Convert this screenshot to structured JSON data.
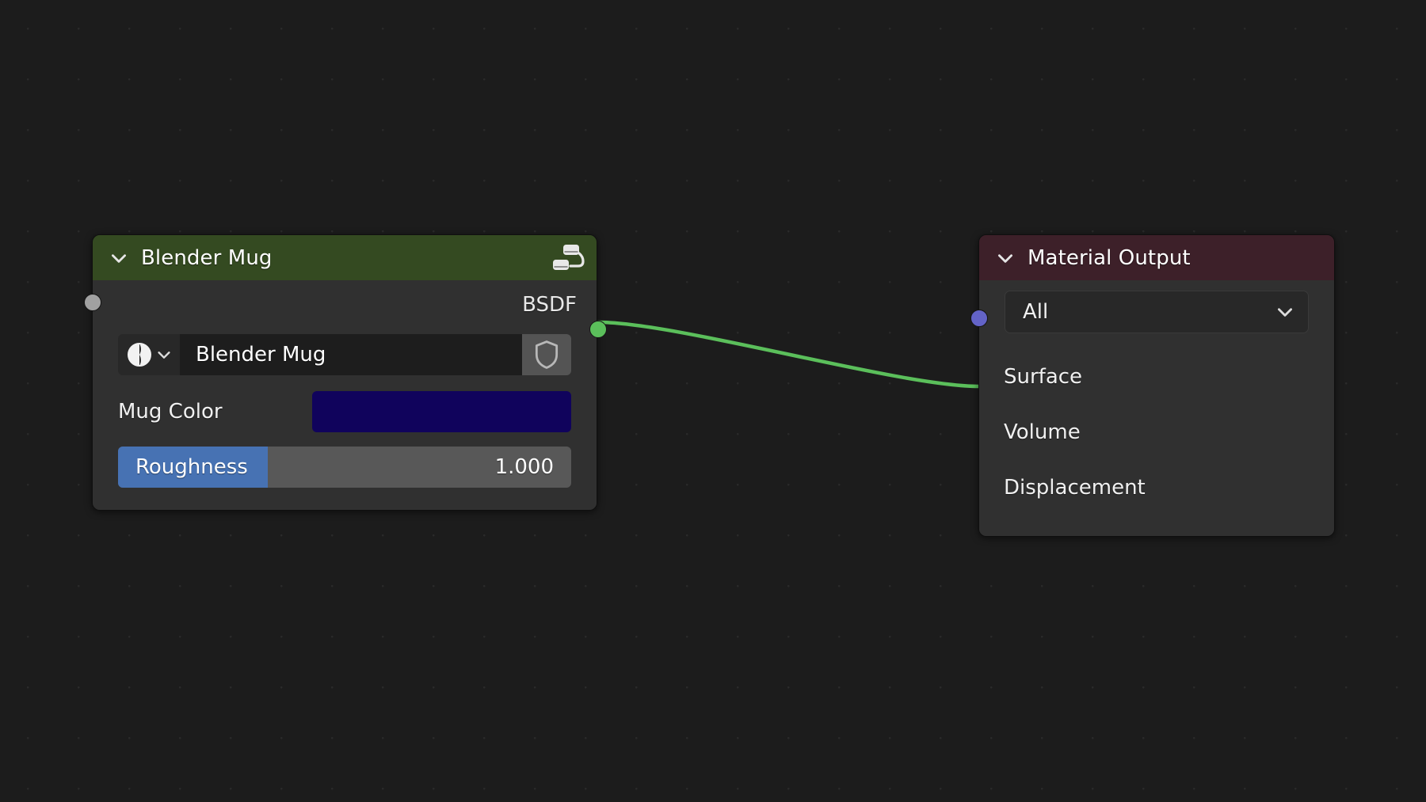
{
  "editor": {
    "name": "shader-node-editor",
    "background_color": "#1c1c1c",
    "grid_dot_color": "#2a2a2a"
  },
  "link": {
    "name": "bsdf-to-surface-link",
    "color": "#5bbf5b",
    "from": "Blender Mug : BSDF",
    "to": "Material Output : Surface"
  },
  "nodes": [
    {
      "id": "blender-mug",
      "title": "Blender Mug",
      "header_color": "#344a21",
      "body_color": "#303030",
      "collapse_icon": "chevron-down-icon",
      "header_icon": "node-group-icon",
      "outputs": [
        {
          "label": "BSDF",
          "socket_color": "#5bbf5b",
          "socket_name": "shader-socket"
        }
      ],
      "datablock": {
        "browse_icon": "material-sphere-icon",
        "browse_chevron": "chevron-down-icon",
        "value": "Blender Mug",
        "fake_user_icon": "shield-icon",
        "fake_user_enabled": "true"
      },
      "properties": [
        {
          "type": "color",
          "label": "Mug Color",
          "socket_color": "#d9d128",
          "socket_name": "color-socket",
          "value_color": "#10035c"
        },
        {
          "type": "slider",
          "label": "Roughness",
          "socket_color": "#a1a1a1",
          "socket_name": "value-socket",
          "value": "1.000",
          "fill_percent": 33,
          "fill_color": "#4772b3",
          "track_color": "#585858"
        }
      ]
    },
    {
      "id": "material-output",
      "title": "Material Output",
      "header_color": "#3d2029",
      "body_color": "#303030",
      "collapse_icon": "chevron-down-icon",
      "dropdown": {
        "label": "All",
        "chevron": "chevron-down-icon"
      },
      "inputs": [
        {
          "label": "Surface",
          "socket_color": "#5bbf5b",
          "socket_name": "shader-socket"
        },
        {
          "label": "Volume",
          "socket_color": "#5bbf5b",
          "socket_name": "shader-socket"
        },
        {
          "label": "Displacement",
          "socket_color": "#6363c7",
          "socket_name": "vector-socket"
        }
      ]
    }
  ]
}
